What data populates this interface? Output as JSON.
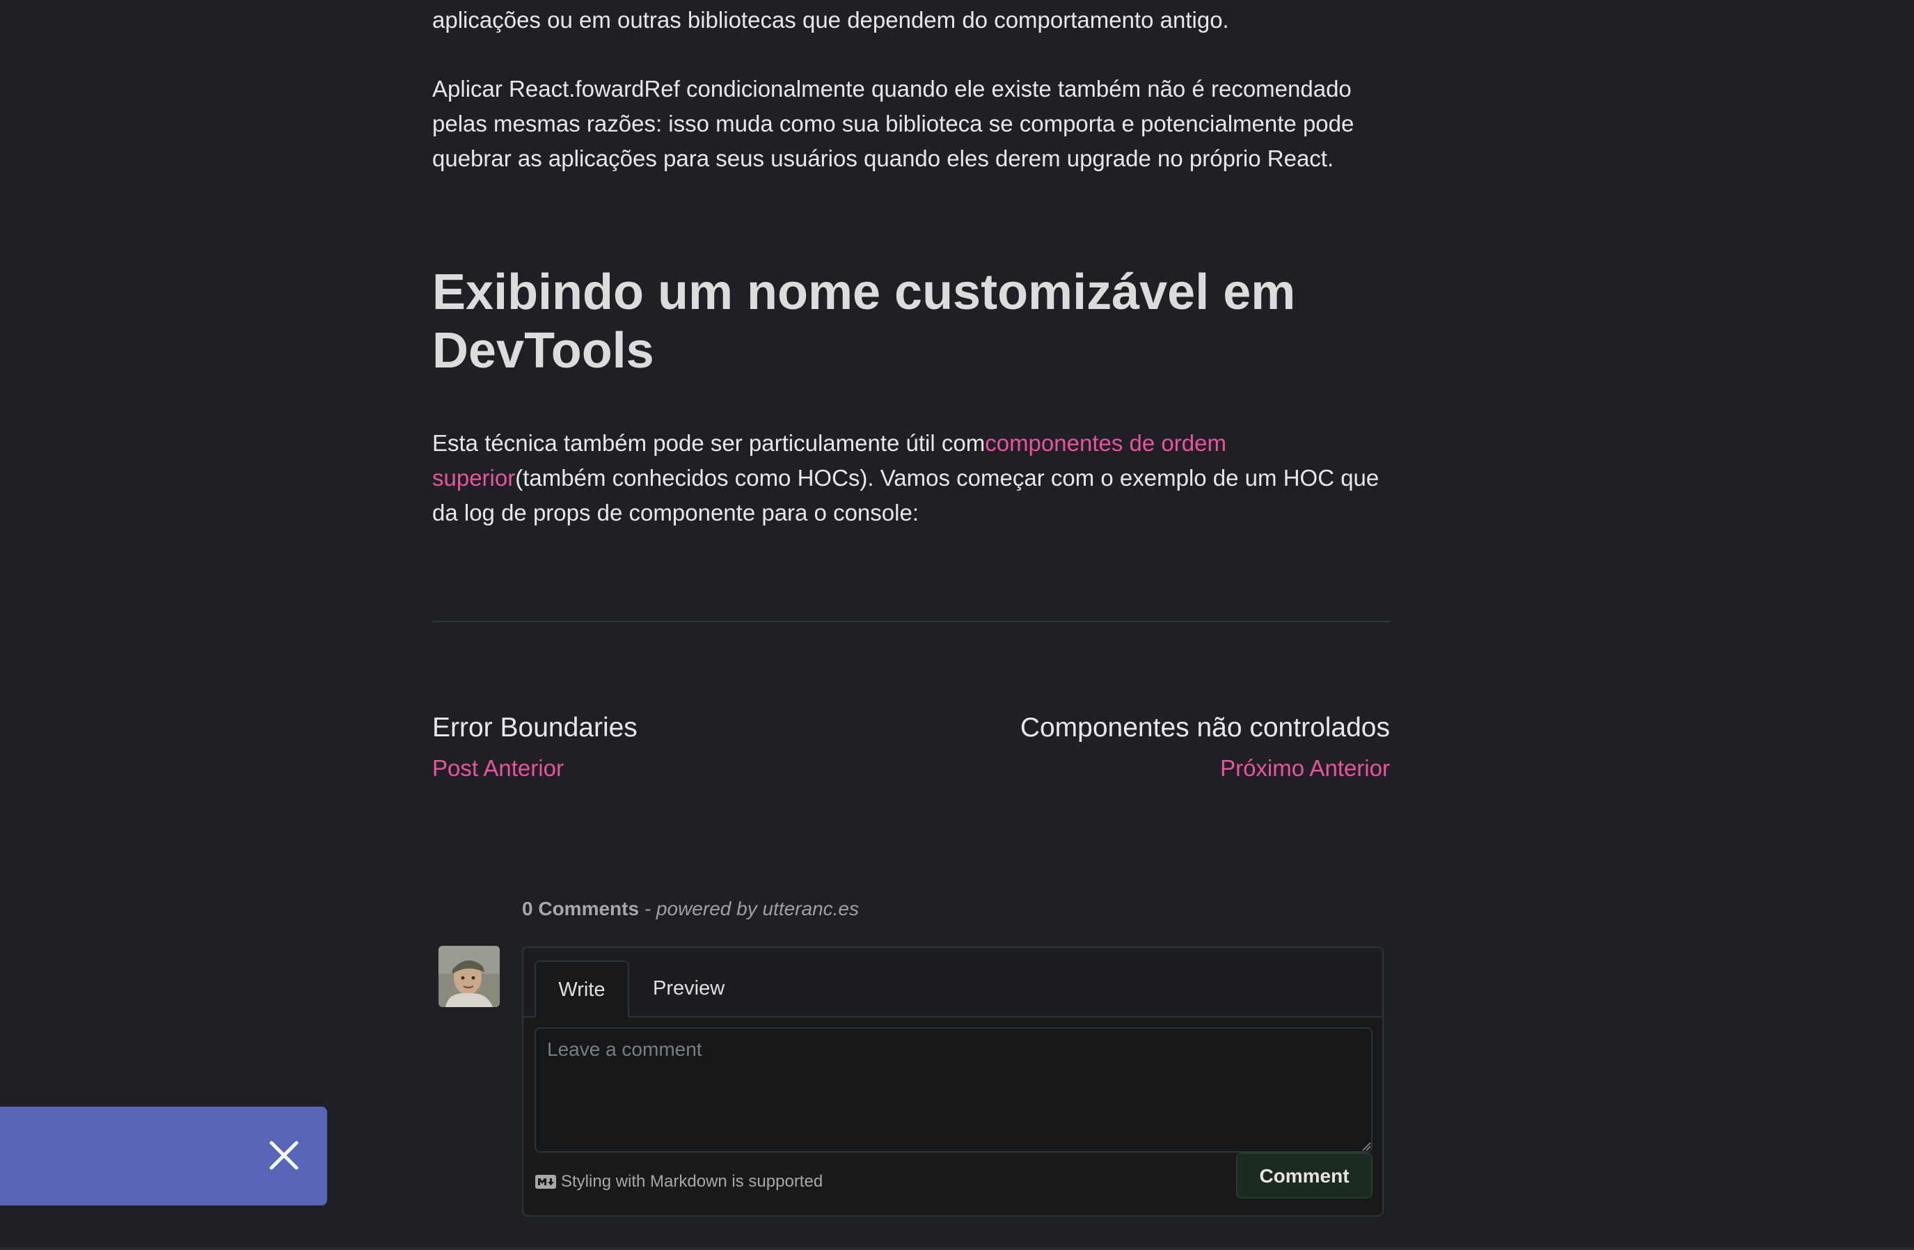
{
  "article": {
    "p_top": "aplicações ou em outras bibliotecas que dependem do comportamento antigo.",
    "p_forwardref": "Aplicar React.fowardRef condicionalmente quando ele existe também não é recomendado pelas mesmas razões: isso muda como sua biblioteca se comporta e potencialmente pode quebrar as aplicações para seus usuários quando eles derem upgrade no próprio React.",
    "heading": "Exibindo um nome customizável em DevTools",
    "p_hoc_before": "Esta técnica também pode ser particulamente útil com",
    "p_hoc_link": "componentes de ordem superior",
    "p_hoc_after": "(também conhecidos como HOCs). Vamos começar com o exemplo de um HOC que da log de props de componente para o console:"
  },
  "post_nav": {
    "prev_title": "Error Boundaries",
    "prev_label": "Post Anterior",
    "next_title": "Componentes não controlados",
    "next_label": "Próximo Anterior"
  },
  "comments": {
    "count_label": "0 Comments",
    "powered_by": " - powered by utteranc.es",
    "tab_write": "Write",
    "tab_preview": "Preview",
    "placeholder": "Leave a comment",
    "markdown_hint": "Styling with Markdown is supported",
    "submit_label": "Comment"
  },
  "colors": {
    "background": "#1e2026",
    "link": "#e8559a",
    "toast": "#5766b7"
  },
  "icons": {
    "toast_close": "close-icon",
    "markdown": "markdown-icon",
    "avatar": "user-avatar"
  }
}
